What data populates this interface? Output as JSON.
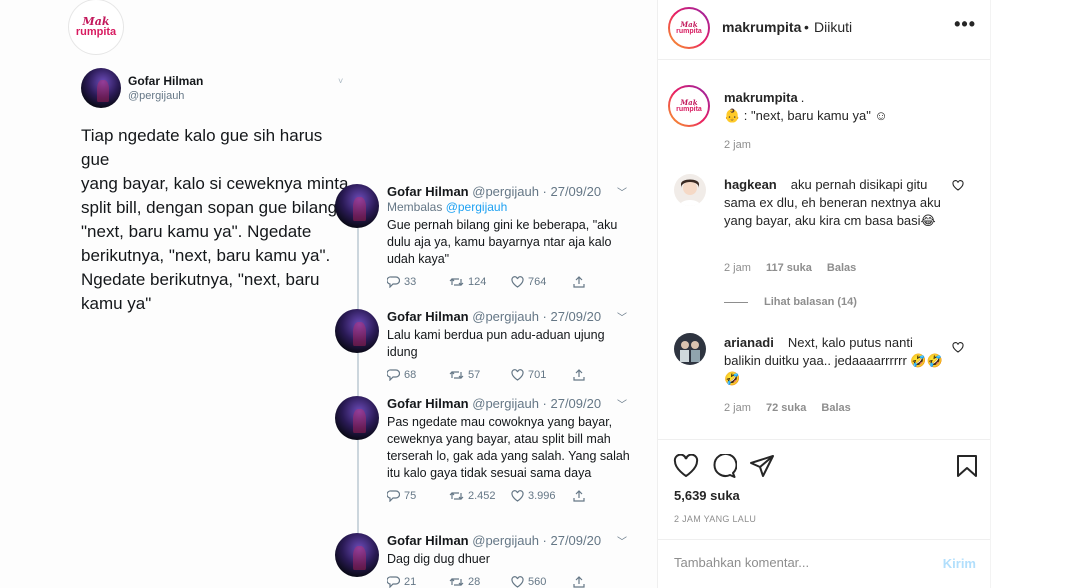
{
  "brand": {
    "line1": "Mak",
    "line2": "rumpita"
  },
  "main_tweet": {
    "name": "Gofar Hilman",
    "handle": "@pergijauh",
    "text": "Tiap ngedate kalo gue sih harus gue\nyang bayar, kalo si ceweknya minta\nsplit bill, dengan sopan gue bilang\n\"next, baru kamu ya\". Ngedate\nberikutnya, \"next, baru kamu ya\".\nNgedate berikutnya, \"next, baru\nkamu ya\""
  },
  "replies": [
    {
      "name": "Gofar Hilman",
      "meta": "@pergijauh · 27/09/20",
      "reply_to_label": "Membalas",
      "reply_to_handle": "@pergijauh",
      "text": "Gue pernah bilang gini ke beberapa, \"aku dulu aja ya, kamu bayarnya ntar aja kalo udah kaya\"",
      "replies": "33",
      "retweets": "124",
      "likes": "764"
    },
    {
      "name": "Gofar Hilman",
      "meta": "@pergijauh · 27/09/20",
      "text": "Lalu kami berdua pun adu-aduan ujung idung",
      "replies": "68",
      "retweets": "57",
      "likes": "701"
    },
    {
      "name": "Gofar Hilman",
      "meta": "@pergijauh · 27/09/20",
      "text": "Pas ngedate mau cowoknya yang bayar, ceweknya yang bayar, atau split bill mah terserah lo, gak ada yang salah. Yang salah itu kalo gaya tidak sesuai sama daya",
      "replies": "75",
      "retweets": "2.452",
      "likes": "3.996"
    },
    {
      "name": "Gofar Hilman",
      "meta": "@pergijauh · 27/09/20",
      "text": "Dag dig dug dhuer",
      "replies": "21",
      "retweets": "28",
      "likes": "560"
    }
  ],
  "header": {
    "username": "makrumpita",
    "dot": "•",
    "follow_status": "Diikuti",
    "more": "•••"
  },
  "caption": {
    "username": "makrumpita",
    "text_line1": ".",
    "text_line2": "👶 : \"next, baru kamu ya\" ☺",
    "time": "2 jam"
  },
  "comments": [
    {
      "username": "hagkean",
      "text": "aku pernah disikapi gitu sama ex dlu, eh beneran nextnya aku yang bayar, aku kira cm basa basi😂",
      "time": "2 jam",
      "likes": "117 suka",
      "reply": "Balas"
    },
    {
      "username": "arianadi",
      "text": "Next, kalo putus nanti balikin duitku yaa.. jedaaaarrrrrr 🤣🤣🤣",
      "time": "2 jam",
      "likes": "72 suka",
      "reply": "Balas"
    }
  ],
  "view_replies": "Lihat balasan (14)",
  "post_stats": {
    "likes": "5,639 suka",
    "time_ago": "2 JAM YANG LALU"
  },
  "comment_box": {
    "placeholder": "Tambahkan komentar...",
    "post_label": "Kirim"
  },
  "colors": {
    "ig_text": "#262626",
    "ig_secondary": "#8e8e8e",
    "post_button": "#b2dffc",
    "twitter_blue": "#1da1f2",
    "brand_pink": "#d81b60"
  }
}
